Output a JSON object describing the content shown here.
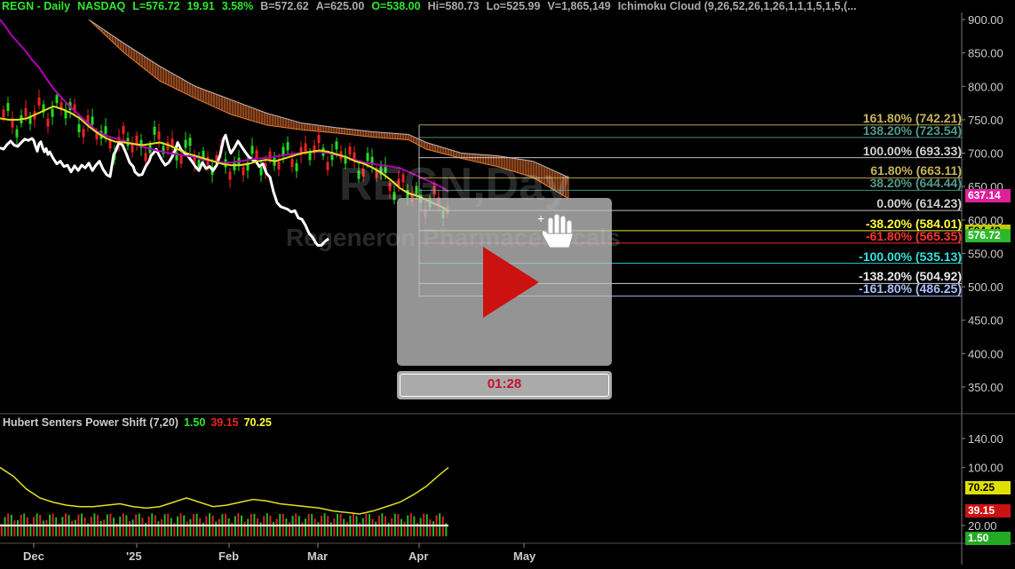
{
  "header": {
    "symbol": "REGN - Daily",
    "exchange": "NASDAQ",
    "last": "L=576.72",
    "change": "19.91",
    "change_pct": "3.58%",
    "bid": "B=572.62",
    "ask": "A=625.00",
    "open": "O=538.00",
    "high": "Hi=580.73",
    "low": "Lo=525.99",
    "volume": "V=1,865,149",
    "study": "Ichimoku Cloud (9,26,52,26,1,26,1,1,1,5,1,5,(..."
  },
  "watermark": {
    "ticker": "REGN,Day",
    "company": "Regeneron Pharmaceuticals"
  },
  "indicator": {
    "name": "Hubert Senters Power Shift (7,20)",
    "v1": "1.50",
    "v2": "39.15",
    "v3": "70.25"
  },
  "fib_levels": [
    {
      "label": "161.80% (742.21)",
      "price": 742.21,
      "color": "#c8b45a"
    },
    {
      "label": "138.20% (723.54)",
      "price": 723.54,
      "color": "#4f9a8c"
    },
    {
      "label": "100.00% (693.33)",
      "price": 693.33,
      "color": "#d0d0d0"
    },
    {
      "label": "61.80% (663.11)",
      "price": 663.11,
      "color": "#c8b45a"
    },
    {
      "label": "38.20% (644.44)",
      "price": 644.44,
      "color": "#4f9a8c"
    },
    {
      "label": "0.00% (614.23)",
      "price": 614.23,
      "color": "#d0d0d0"
    },
    {
      "label": "-38.20% (584.01)",
      "price": 584.01,
      "color": "#ffff33"
    },
    {
      "label": "-61.80% (565.35)",
      "price": 565.35,
      "color": "#ff3333"
    },
    {
      "label": "-100.00% (535.13)",
      "price": 535.13,
      "color": "#33e0e0"
    },
    {
      "label": "-138.20% (504.92)",
      "price": 504.92,
      "color": "#e8e8e8"
    },
    {
      "label": "-161.80% (486.25)",
      "price": 486.25,
      "color": "#a8c0ff"
    }
  ],
  "price_tags": [
    {
      "text": "637.14",
      "price": 637.14,
      "bg": "#e0209a",
      "fg": "#ffffff"
    },
    {
      "text": "584.48",
      "price": 584.48,
      "bg": "#c8c800",
      "fg": "#000000"
    },
    {
      "text": "576.72",
      "price": 576.72,
      "bg": "#2eb82e",
      "fg": "#ffffff"
    }
  ],
  "indicator_tags": [
    {
      "text": "70.25",
      "value": 70.25,
      "bg": "#e0e000",
      "fg": "#000000"
    },
    {
      "text": "39.15",
      "value": 39.15,
      "bg": "#cc1111",
      "fg": "#ffffff"
    },
    {
      "text": "1.50",
      "value": 1.5,
      "bg": "#22aa22",
      "fg": "#ffffff"
    }
  ],
  "player": {
    "time": "01:28"
  },
  "chart_data": {
    "type": "line",
    "price_axis": {
      "ticks": [
        "900.00",
        "850.00",
        "800.00",
        "750.00",
        "700.00",
        "650.00",
        "600.00",
        "550.00",
        "500.00",
        "450.00",
        "400.00",
        "350.00"
      ],
      "ylim": [
        325,
        910
      ]
    },
    "indicator_axis": {
      "ticks": [
        "140.00",
        "100.00",
        "20.00"
      ],
      "ylim": [
        0,
        150
      ]
    },
    "x_ticks": [
      "Dec",
      "'25",
      "Feb",
      "Mar",
      "Apr",
      "May"
    ],
    "series": [
      {
        "color": "#ffffff",
        "values": [
          [
            0,
            708
          ],
          [
            4,
            706
          ],
          [
            8,
            713
          ],
          [
            12,
            718
          ],
          [
            16,
            712
          ],
          [
            20,
            710
          ],
          [
            24,
            716
          ],
          [
            28,
            721
          ],
          [
            32,
            719
          ],
          [
            36,
            722
          ],
          [
            38,
            719
          ],
          [
            40,
            710
          ],
          [
            42,
            703
          ],
          [
            44,
            714
          ],
          [
            46,
            717
          ],
          [
            48,
            708
          ],
          [
            50,
            702
          ],
          [
            52,
            707
          ],
          [
            54,
            698
          ],
          [
            56,
            702
          ],
          [
            60,
            692
          ],
          [
            64,
            684
          ],
          [
            68,
            688
          ],
          [
            72,
            680
          ],
          [
            76,
            682
          ],
          [
            80,
            672
          ],
          [
            84,
            681
          ],
          [
            88,
            674
          ],
          [
            92,
            682
          ],
          [
            96,
            678
          ],
          [
            100,
            685
          ],
          [
            104,
            674
          ],
          [
            108,
            682
          ],
          [
            112,
            688
          ],
          [
            116,
            676
          ],
          [
            120,
            668
          ],
          [
            124,
            665
          ],
          [
            128,
            698
          ],
          [
            130,
            702
          ],
          [
            134,
            716
          ],
          [
            138,
            712
          ],
          [
            140,
            706
          ],
          [
            142,
            700
          ],
          [
            146,
            686
          ],
          [
            150,
            680
          ],
          [
            152,
            672
          ],
          [
            156,
            667
          ],
          [
            160,
            668
          ],
          [
            164,
            680
          ],
          [
            168,
            688
          ],
          [
            170,
            696
          ],
          [
            174,
            702
          ],
          [
            176,
            706
          ],
          [
            178,
            700
          ],
          [
            182,
            690
          ],
          [
            186,
            682
          ],
          [
            190,
            686
          ],
          [
            194,
            695
          ],
          [
            198,
            707
          ],
          [
            200,
            716
          ],
          [
            204,
            705
          ],
          [
            208,
            700
          ],
          [
            212,
            695
          ],
          [
            216,
            688
          ],
          [
            220,
            680
          ],
          [
            224,
            674
          ],
          [
            228,
            686
          ],
          [
            232,
            677
          ],
          [
            236,
            680
          ],
          [
            240,
            674
          ],
          [
            244,
            682
          ],
          [
            248,
            698
          ],
          [
            252,
            722
          ],
          [
            254,
            727
          ],
          [
            256,
            717
          ],
          [
            258,
            707
          ],
          [
            260,
            700
          ],
          [
            264,
            708
          ],
          [
            268,
            718
          ],
          [
            272,
            710
          ],
          [
            276,
            702
          ],
          [
            280,
            695
          ],
          [
            284,
            690
          ],
          [
            288,
            688
          ],
          [
            292,
            680
          ],
          [
            296,
            684
          ],
          [
            300,
            670
          ],
          [
            304,
            664
          ],
          [
            308,
            642
          ],
          [
            312,
            626
          ],
          [
            316,
            620
          ],
          [
            320,
            618
          ],
          [
            324,
            616
          ],
          [
            328,
            612
          ],
          [
            332,
            614
          ],
          [
            336,
            603
          ],
          [
            340,
            601
          ],
          [
            344,
            592
          ],
          [
            348,
            580
          ],
          [
            352,
            574
          ],
          [
            356,
            565
          ],
          [
            358,
            562
          ],
          [
            362,
            562
          ],
          [
            366,
            568
          ],
          [
            370,
            572
          ]
        ]
      },
      {
        "color": "#b000b0",
        "values": [
          [
            0,
            900
          ],
          [
            6,
            890
          ],
          [
            12,
            878
          ],
          [
            20,
            866
          ],
          [
            28,
            854
          ],
          [
            36,
            840
          ],
          [
            44,
            828
          ],
          [
            52,
            812
          ],
          [
            60,
            797
          ],
          [
            70,
            782
          ],
          [
            80,
            768
          ],
          [
            90,
            756
          ],
          [
            100,
            744
          ],
          [
            110,
            732
          ],
          [
            120,
            726
          ],
          [
            130,
            722
          ],
          [
            140,
            718
          ],
          [
            150,
            714
          ],
          [
            160,
            710
          ],
          [
            170,
            706
          ],
          [
            180,
            703
          ],
          [
            190,
            700
          ],
          [
            200,
            698
          ],
          [
            210,
            696
          ],
          [
            220,
            694
          ],
          [
            230,
            690
          ],
          [
            240,
            688
          ],
          [
            250,
            686
          ],
          [
            260,
            686
          ],
          [
            270,
            688
          ],
          [
            280,
            690
          ],
          [
            290,
            692
          ],
          [
            300,
            693
          ],
          [
            310,
            695
          ],
          [
            320,
            697
          ],
          [
            330,
            699
          ],
          [
            340,
            700
          ],
          [
            350,
            702
          ],
          [
            360,
            702
          ],
          [
            370,
            700
          ],
          [
            380,
            697
          ],
          [
            390,
            694
          ],
          [
            400,
            690
          ],
          [
            410,
            686
          ],
          [
            420,
            684
          ],
          [
            430,
            682
          ],
          [
            440,
            680
          ],
          [
            450,
            678
          ],
          [
            460,
            672
          ],
          [
            470,
            666
          ],
          [
            480,
            660
          ],
          [
            490,
            654
          ],
          [
            500,
            647
          ],
          [
            505,
            642
          ]
        ]
      },
      {
        "color": "#e0e020",
        "values": [
          [
            0,
            752
          ],
          [
            10,
            750
          ],
          [
            20,
            750
          ],
          [
            30,
            752
          ],
          [
            40,
            758
          ],
          [
            50,
            764
          ],
          [
            60,
            770
          ],
          [
            70,
            766
          ],
          [
            80,
            760
          ],
          [
            90,
            752
          ],
          [
            100,
            740
          ],
          [
            110,
            730
          ],
          [
            120,
            722
          ],
          [
            130,
            717
          ],
          [
            140,
            716
          ],
          [
            150,
            714
          ],
          [
            160,
            712
          ],
          [
            170,
            714
          ],
          [
            180,
            716
          ],
          [
            190,
            712
          ],
          [
            200,
            706
          ],
          [
            210,
            700
          ],
          [
            220,
            696
          ],
          [
            230,
            692
          ],
          [
            240,
            688
          ],
          [
            250,
            684
          ],
          [
            260,
            682
          ],
          [
            270,
            682
          ],
          [
            280,
            684
          ],
          [
            290,
            688
          ],
          [
            300,
            690
          ],
          [
            310,
            688
          ],
          [
            320,
            692
          ],
          [
            330,
            696
          ],
          [
            340,
            700
          ],
          [
            350,
            702
          ],
          [
            360,
            704
          ],
          [
            370,
            702
          ],
          [
            380,
            698
          ],
          [
            390,
            694
          ],
          [
            400,
            688
          ],
          [
            410,
            684
          ],
          [
            420,
            678
          ],
          [
            430,
            670
          ],
          [
            440,
            660
          ],
          [
            450,
            648
          ],
          [
            460,
            640
          ],
          [
            470,
            636
          ],
          [
            480,
            630
          ],
          [
            490,
            624
          ],
          [
            500,
            618
          ],
          [
            505,
            612
          ]
        ]
      }
    ],
    "cloud_top": [
      [
        100,
        900
      ],
      [
        140,
        864
      ],
      [
        180,
        830
      ],
      [
        220,
        800
      ],
      [
        260,
        780
      ],
      [
        300,
        760
      ],
      [
        340,
        745
      ],
      [
        380,
        738
      ],
      [
        420,
        732
      ],
      [
        460,
        728
      ],
      [
        480,
        716
      ],
      [
        520,
        700
      ],
      [
        560,
        696
      ],
      [
        600,
        688
      ],
      [
        640,
        664
      ]
    ],
    "cloud_bottom": [
      [
        100,
        900
      ],
      [
        140,
        850
      ],
      [
        180,
        808
      ],
      [
        220,
        782
      ],
      [
        260,
        758
      ],
      [
        300,
        742
      ],
      [
        340,
        735
      ],
      [
        380,
        730
      ],
      [
        420,
        724
      ],
      [
        460,
        720
      ],
      [
        480,
        706
      ],
      [
        520,
        692
      ],
      [
        560,
        680
      ],
      [
        600,
        664
      ],
      [
        640,
        632
      ]
    ],
    "ind_line": [
      [
        0,
        100
      ],
      [
        15,
        88
      ],
      [
        30,
        70
      ],
      [
        45,
        58
      ],
      [
        60,
        52
      ],
      [
        75,
        48
      ],
      [
        90,
        46
      ],
      [
        105,
        46
      ],
      [
        120,
        48
      ],
      [
        135,
        50
      ],
      [
        150,
        46
      ],
      [
        165,
        44
      ],
      [
        180,
        46
      ],
      [
        195,
        52
      ],
      [
        210,
        58
      ],
      [
        225,
        52
      ],
      [
        240,
        46
      ],
      [
        255,
        48
      ],
      [
        270,
        52
      ],
      [
        285,
        56
      ],
      [
        300,
        54
      ],
      [
        315,
        50
      ],
      [
        330,
        48
      ],
      [
        345,
        46
      ],
      [
        360,
        44
      ],
      [
        375,
        40
      ],
      [
        390,
        38
      ],
      [
        405,
        36
      ],
      [
        420,
        40
      ],
      [
        435,
        46
      ],
      [
        450,
        52
      ],
      [
        465,
        62
      ],
      [
        480,
        74
      ],
      [
        495,
        90
      ],
      [
        505,
        100
      ]
    ]
  }
}
